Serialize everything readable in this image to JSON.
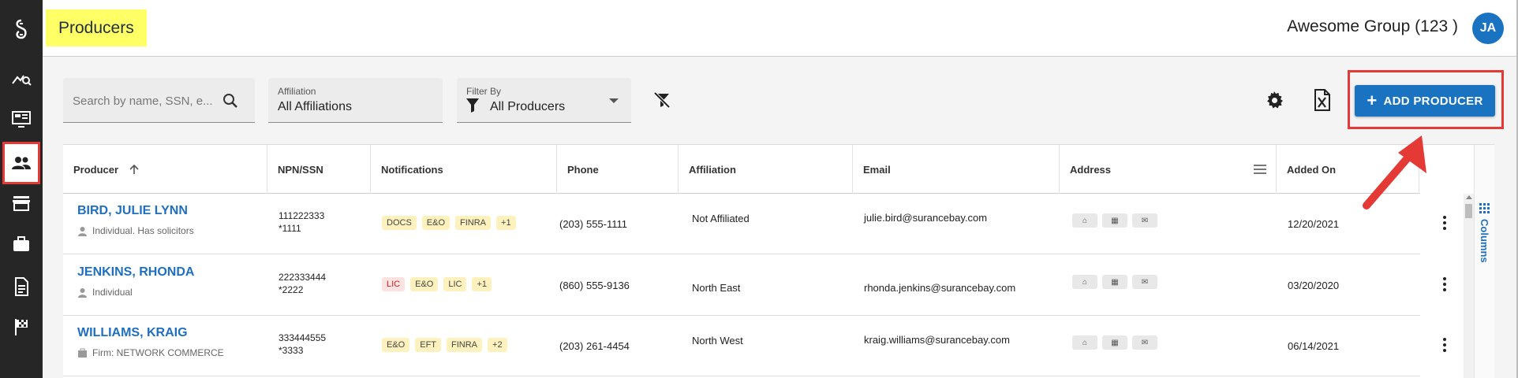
{
  "sidebar": {
    "items": [
      {
        "name": "logo-icon"
      },
      {
        "name": "analytics-icon"
      },
      {
        "name": "dashboard-icon"
      },
      {
        "name": "people-icon",
        "active": true
      },
      {
        "name": "store-icon"
      },
      {
        "name": "briefcase-icon"
      },
      {
        "name": "document-icon"
      },
      {
        "name": "flag-icon"
      }
    ]
  },
  "header": {
    "title": "Producers",
    "group_name": "Awesome Group",
    "group_count": "(123 )",
    "avatar_initials": "JA"
  },
  "filters": {
    "search_placeholder": "Search by name, SSN, e...",
    "affiliation_label": "Affiliation",
    "affiliation_value": "All Affiliations",
    "filter_by_label": "Filter By",
    "filter_by_value": "All Producers"
  },
  "toolbar": {
    "add_producer_label": "ADD PRODUCER"
  },
  "table": {
    "columns": [
      "Producer",
      "NPN/SSN",
      "Notifications",
      "Phone",
      "Affiliation",
      "Email",
      "Address",
      "Added On"
    ],
    "columns_panel_label": "Columns",
    "rows": [
      {
        "name": "BIRD, JULIE LYNN",
        "subtitle": "Individual. Has solicitors",
        "subtitle_icon": "person-icon",
        "npn": "111222333",
        "ssn": "*1111",
        "badges": [
          {
            "text": "DOCS",
            "tone": "yellow"
          },
          {
            "text": "E&O",
            "tone": "yellow"
          },
          {
            "text": "FINRA",
            "tone": "yellow"
          },
          {
            "text": "+1",
            "tone": "yellow"
          }
        ],
        "phone": "(203) 555-1111",
        "affiliation": "Not Affiliated",
        "email": "julie.bird@surancebay.com",
        "added_on": "12/20/2021"
      },
      {
        "name": "JENKINS, RHONDA",
        "subtitle": "Individual",
        "subtitle_icon": "person-icon",
        "npn": "222333444",
        "ssn": "*2222",
        "badges": [
          {
            "text": "LIC",
            "tone": "red"
          },
          {
            "text": "E&O",
            "tone": "yellow"
          },
          {
            "text": "LIC",
            "tone": "yellow"
          },
          {
            "text": "+1",
            "tone": "yellow"
          }
        ],
        "phone": "(860) 555-9136",
        "affiliation": "North East",
        "email": "rhonda.jenkins@surancebay.com",
        "added_on": "03/20/2020"
      },
      {
        "name": "WILLIAMS, KRAIG",
        "subtitle": "Firm: NETWORK COMMERCE",
        "subtitle_icon": "firm-icon",
        "npn": "333444555",
        "ssn": "*3333",
        "badges": [
          {
            "text": "E&O",
            "tone": "yellow"
          },
          {
            "text": "EFT",
            "tone": "yellow"
          },
          {
            "text": "FINRA",
            "tone": "yellow"
          },
          {
            "text": "+2",
            "tone": "yellow"
          }
        ],
        "phone": "(203) 261-4454",
        "affiliation": "North West",
        "email": "kraig.williams@surancebay.com",
        "added_on": "06/14/2021"
      }
    ]
  },
  "colors": {
    "accent": "#1a73c0",
    "highlight": "#ffff66",
    "annotation": "#e53935",
    "sidebar": "#262626"
  }
}
